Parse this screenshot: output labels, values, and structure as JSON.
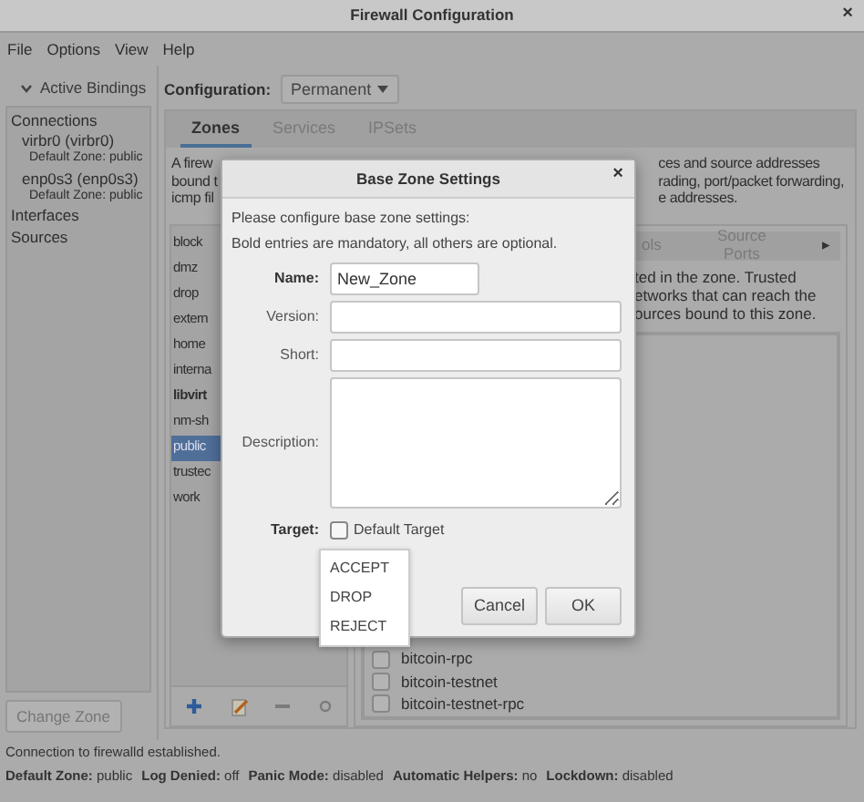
{
  "window": {
    "title": "Firewall Configuration",
    "close": "×"
  },
  "menu": [
    "File",
    "Options",
    "View",
    "Help"
  ],
  "sidebar": {
    "header": {
      "label": "Active Bindings",
      "expanded": true
    },
    "items": [
      {
        "kind": "section",
        "label": "Connections"
      },
      {
        "kind": "connection",
        "label": "virbr0 (virbr0)",
        "detail": "Default Zone: public"
      },
      {
        "kind": "connection",
        "label": "enp0s3 (enp0s3)",
        "detail": "Default Zone: public"
      },
      {
        "kind": "section",
        "label": "Interfaces"
      },
      {
        "kind": "section",
        "label": "Sources"
      }
    ],
    "button": "Change Zone"
  },
  "configuration": {
    "label": "Configuration:",
    "value": "Permanent"
  },
  "tabs": [
    {
      "label": "Zones",
      "selected": true
    },
    {
      "label": "Services",
      "selected": false
    },
    {
      "label": "IPSets",
      "selected": false
    }
  ],
  "zone_description": {
    "left": [
      "A firew",
      "bound t",
      "icmp fil"
    ],
    "right": [
      "ces and source addresses",
      "rading, port/packet forwarding,",
      "e addresses."
    ]
  },
  "zones": [
    {
      "name": "block",
      "bold": false,
      "selected": false
    },
    {
      "name": "dmz",
      "bold": false,
      "selected": false
    },
    {
      "name": "drop",
      "bold": false,
      "selected": false
    },
    {
      "name": "extern",
      "bold": false,
      "selected": false
    },
    {
      "name": "home",
      "bold": false,
      "selected": false
    },
    {
      "name": "interna",
      "bold": false,
      "selected": false
    },
    {
      "name": "libvirt",
      "bold": true,
      "selected": false
    },
    {
      "name": "nm-sh",
      "bold": false,
      "selected": false
    },
    {
      "name": "public",
      "bold": false,
      "selected": true
    },
    {
      "name": "trustec",
      "bold": false,
      "selected": false
    },
    {
      "name": "work",
      "bold": false,
      "selected": false
    }
  ],
  "zone_tabs": {
    "items": [
      "ols",
      "Source Ports"
    ],
    "more": "▸"
  },
  "zone_info": [
    "ted in the zone. Trusted",
    "etworks that can reach the",
    "ources bound to this zone."
  ],
  "services": [
    {
      "name": "bitcoin-rpc",
      "checked": false
    },
    {
      "name": "bitcoin-testnet",
      "checked": false
    },
    {
      "name": "bitcoin-testnet-rpc",
      "checked": false
    }
  ],
  "dialog": {
    "title": "Base Zone Settings",
    "close": "×",
    "intro": [
      "Please configure base zone settings:",
      "Bold entries are mandatory, all others are optional."
    ],
    "fields": [
      {
        "kind": "short-line",
        "label": "Name:",
        "mandatory": true,
        "value": "New_Zone"
      },
      {
        "kind": "line",
        "label": "Version:",
        "mandatory": false
      },
      {
        "kind": "line",
        "label": "Short:",
        "mandatory": false
      },
      {
        "kind": "area",
        "label": "Description:",
        "mandatory": false
      }
    ],
    "target": {
      "label": "Target:",
      "mandatory": true,
      "checkbox": {
        "label": "Default Target",
        "checked": false
      }
    },
    "target_menu": [
      "ACCEPT",
      "DROP",
      "REJECT"
    ],
    "buttons": [
      "Cancel",
      "OK"
    ]
  },
  "status": {
    "message": "Connection to firewalld established.",
    "items": [
      {
        "label": "Default Zone:",
        "value": "public"
      },
      {
        "label": "Log Denied:",
        "value": "off"
      },
      {
        "label": "Panic Mode:",
        "value": "disabled"
      },
      {
        "label": "Automatic Helpers:",
        "value": "no"
      },
      {
        "label": "Lockdown:",
        "value": "disabled"
      }
    ]
  }
}
